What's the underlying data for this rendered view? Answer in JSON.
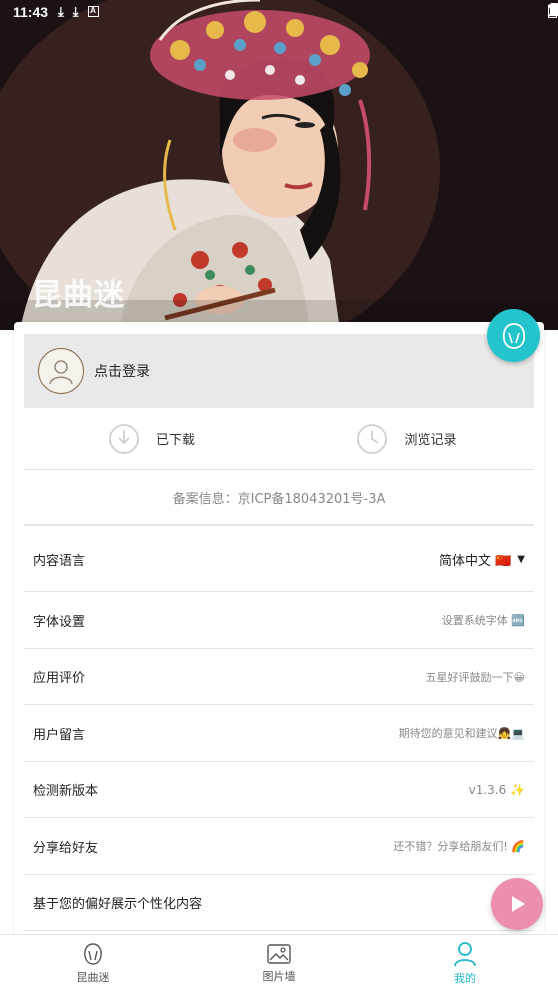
{
  "status_bar": {
    "time": "11:43",
    "left_icons": [
      "download-icon",
      "download-icon",
      "a-badge-icon"
    ],
    "right_icons": [
      "wifi-icon",
      "signal-icon",
      "battery-icon"
    ]
  },
  "hero": {
    "app_watermark": "昆曲迷"
  },
  "login": {
    "label": "点击登录"
  },
  "quick_actions": [
    {
      "label": "已下载",
      "icon": "download-circle-icon"
    },
    {
      "label": "浏览记录",
      "icon": "clock-icon"
    }
  ],
  "icp": {
    "text": "备案信息：京ICP备18043201号-3A"
  },
  "settings": [
    {
      "label": "内容语言",
      "value": "简体中文 🇨🇳",
      "has_dropdown": true
    },
    {
      "label": "字体设置",
      "value": "设置系统字体 🔤"
    },
    {
      "label": "应用评价",
      "value": "五星好评鼓励一下😀"
    },
    {
      "label": "用户留言",
      "value": "期待您的意见和建议👧💻"
    },
    {
      "label": "检测新版本",
      "value": "v1.3.6 ✨"
    },
    {
      "label": "分享给好友",
      "value": "还不错？分享给朋友们! 🌈"
    },
    {
      "label": "基于您的偏好展示个性化内容",
      "value": ""
    }
  ],
  "bottom_nav": [
    {
      "label": "昆曲迷",
      "icon": "opera-mask-icon",
      "active": false
    },
    {
      "label": "图片墙",
      "icon": "image-icon",
      "active": false
    },
    {
      "label": "我的",
      "icon": "person-icon",
      "active": true
    }
  ],
  "colors": {
    "accent": "#1fb8c8",
    "fab_top": "#23c4cc",
    "fab_play": "#ec8fae"
  }
}
